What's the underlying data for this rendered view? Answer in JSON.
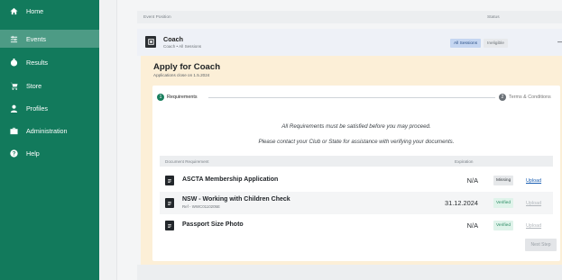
{
  "sidebar": {
    "items": [
      {
        "label": "Home",
        "icon": "home-icon"
      },
      {
        "label": "Events",
        "icon": "events-icon",
        "active": true
      },
      {
        "label": "Results",
        "icon": "results-icon"
      },
      {
        "label": "Store",
        "icon": "cart-icon"
      },
      {
        "label": "Profiles",
        "icon": "profile-icon"
      },
      {
        "label": "Administration",
        "icon": "briefcase-icon"
      },
      {
        "label": "Help",
        "icon": "help-icon"
      }
    ],
    "bg_color": "#127a5c"
  },
  "table_header": {
    "col_event": "Event Position",
    "col_status": "Status"
  },
  "position": {
    "title": "Coach",
    "subtitle": "Coach • All Sessions",
    "chip_sessions": "All Sessions",
    "chip_status": "Ineligible",
    "collapse": "—"
  },
  "apply": {
    "title": "Apply for Coach",
    "subtitle": "Applications close on 1.5.2024",
    "steps": [
      {
        "num": "1",
        "label": "Requirements",
        "active": true
      },
      {
        "num": "2",
        "label": "Terms & Conditions",
        "active": false
      }
    ],
    "notice_line1": "All Requirements must be satisfied before you may proceed.",
    "notice_line2": "Please contact your Club or State for assistance with verifying your documents.",
    "doc_header": {
      "requirement": "Document Requirement",
      "expiration": "Expiration"
    },
    "documents": [
      {
        "name": "ASCTA Membership Application",
        "ref": "",
        "expiration": "N/A",
        "status": "Missing",
        "action": "Upload",
        "action_enabled": true
      },
      {
        "name": "NSW - Working with Children Check",
        "ref": "Ref - WWC0110205E",
        "expiration": "31.12.2024",
        "status": "Verified",
        "action": "Upload",
        "action_enabled": false
      },
      {
        "name": "Passport Size Photo",
        "ref": "",
        "expiration": "N/A",
        "status": "Verified",
        "action": "Upload",
        "action_enabled": false
      }
    ],
    "next_button": "Next Step"
  },
  "colors": {
    "accent": "#127a5c",
    "panel": "#fcefd7",
    "verified": "#2a8a63",
    "link": "#1b5fb3"
  }
}
